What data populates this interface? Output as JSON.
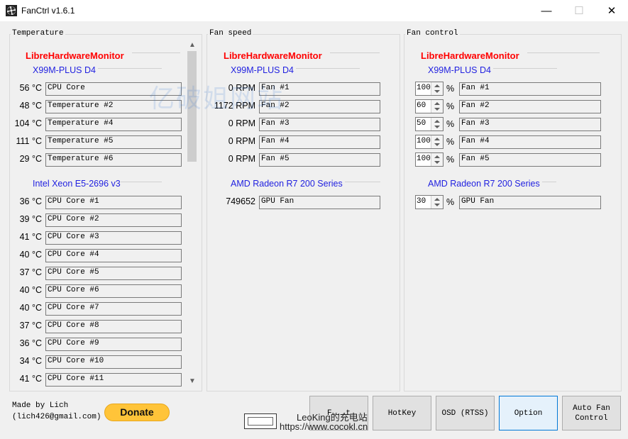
{
  "window": {
    "title": "FanCtrl v1.6.1",
    "minimize": "—",
    "maximize": "☐",
    "close": "✕"
  },
  "temperature": {
    "group_title": "Temperature",
    "provider": "LibreHardwareMonitor",
    "devices": [
      {
        "name": "X99M-PLUS D4",
        "sensors": [
          {
            "value": "56 °C",
            "label": "CPU Core"
          },
          {
            "value": "48 °C",
            "label": "Temperature #2"
          },
          {
            "value": "104 °C",
            "label": "Temperature #4"
          },
          {
            "value": "111 °C",
            "label": "Temperature #5"
          },
          {
            "value": "29 °C",
            "label": "Temperature #6"
          }
        ]
      },
      {
        "name": "Intel Xeon E5-2696 v3",
        "sensors": [
          {
            "value": "36 °C",
            "label": "CPU Core #1"
          },
          {
            "value": "39 °C",
            "label": "CPU Core #2"
          },
          {
            "value": "41 °C",
            "label": "CPU Core #3"
          },
          {
            "value": "40 °C",
            "label": "CPU Core #4"
          },
          {
            "value": "37 °C",
            "label": "CPU Core #5"
          },
          {
            "value": "40 °C",
            "label": "CPU Core #6"
          },
          {
            "value": "40 °C",
            "label": "CPU Core #7"
          },
          {
            "value": "37 °C",
            "label": "CPU Core #8"
          },
          {
            "value": "36 °C",
            "label": "CPU Core #9"
          },
          {
            "value": "34 °C",
            "label": "CPU Core #10"
          },
          {
            "value": "41 °C",
            "label": "CPU Core #11"
          }
        ]
      }
    ]
  },
  "fan_speed": {
    "group_title": "Fan speed",
    "provider": "LibreHardwareMonitor",
    "devices": [
      {
        "name": "X99M-PLUS D4",
        "fans": [
          {
            "value": "0 RPM",
            "label": "Fan #1"
          },
          {
            "value": "1172 RPM",
            "label": "Fan #2"
          },
          {
            "value": "0 RPM",
            "label": "Fan #3"
          },
          {
            "value": "0 RPM",
            "label": "Fan #4"
          },
          {
            "value": "0 RPM",
            "label": "Fan #5"
          }
        ]
      },
      {
        "name": "AMD Radeon R7 200 Series",
        "fans": [
          {
            "value": "749652",
            "label": "GPU Fan"
          }
        ]
      }
    ]
  },
  "fan_control": {
    "group_title": "Fan control",
    "provider": "LibreHardwareMonitor",
    "unit": "%",
    "devices": [
      {
        "name": "X99M-PLUS D4",
        "controls": [
          {
            "value": "100",
            "label": "Fan #1"
          },
          {
            "value": "60",
            "label": "Fan #2"
          },
          {
            "value": "50",
            "label": "Fan #3"
          },
          {
            "value": "100",
            "label": "Fan #4"
          },
          {
            "value": "100",
            "label": "Fan #5"
          }
        ]
      },
      {
        "name": "AMD Radeon R7 200 Series",
        "controls": [
          {
            "value": "30",
            "label": "GPU Fan"
          }
        ]
      }
    ]
  },
  "footer": {
    "made_by": "Made by Lich",
    "email": "(lich426@gmail.com)",
    "donate": "Donate",
    "buttons": {
      "first": "F...t",
      "hotkey": "HotKey",
      "osd": "OSD (RTSS)",
      "option": "Option",
      "auto_line1": "Auto Fan",
      "auto_line2": "Control"
    }
  },
  "watermarks": {
    "center": "亿破姐网站",
    "bottom1": "LeoKing的充电站",
    "bottom2": "https://www.cocokl.cn"
  },
  "colors": {
    "provider": "#ff0000",
    "device": "#1f1fe0",
    "donate": "#ffc439",
    "selected_button_border": "#0078d7"
  },
  "icons": {
    "app": "fan-app-icon",
    "scroll_up": "chevron-up-icon",
    "scroll_down": "chevron-down-icon"
  }
}
